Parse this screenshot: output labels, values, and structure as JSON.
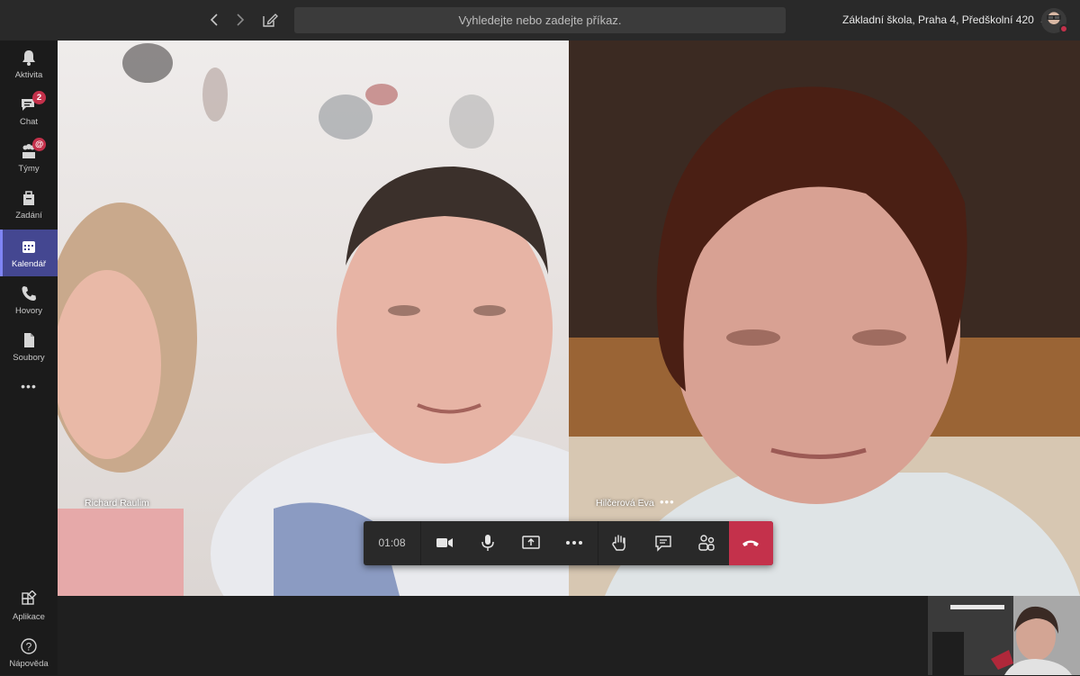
{
  "topbar": {
    "search_placeholder": "Vyhledejte nebo zadejte příkaz.",
    "org_name": "Základní škola, Praha 4, Předškolní 420",
    "back_icon": "chevron-left-icon",
    "forward_icon": "chevron-right-icon",
    "compose_icon": "compose-icon"
  },
  "rail": {
    "items": [
      {
        "label": "Aktivita",
        "icon": "bell-icon"
      },
      {
        "label": "Chat",
        "icon": "chat-icon",
        "badge": "2"
      },
      {
        "label": "Týmy",
        "icon": "teams-icon",
        "badge": "@"
      },
      {
        "label": "Zadání",
        "icon": "assignments-icon"
      },
      {
        "label": "Kalendář",
        "icon": "calendar-icon",
        "active": true
      },
      {
        "label": "Hovory",
        "icon": "phone-icon"
      },
      {
        "label": "Soubory",
        "icon": "files-icon"
      },
      {
        "label": "Aplikace",
        "icon": "apps-icon"
      },
      {
        "label": "Nápověda",
        "icon": "help-icon"
      }
    ],
    "more_label": "•••"
  },
  "participants": [
    {
      "name": "Richard Raulim"
    },
    {
      "name": "Hilčerová Eva",
      "more": "•••"
    }
  ],
  "call": {
    "duration": "01:08",
    "controls": [
      "camera-icon",
      "microphone-icon",
      "share-screen-icon",
      "more-actions-icon",
      "raise-hand-icon",
      "conversation-icon",
      "participants-icon",
      "hang-up-icon"
    ]
  },
  "colors": {
    "accent": "#444791",
    "hangup": "#c4314b",
    "badge": "#c4314b"
  }
}
